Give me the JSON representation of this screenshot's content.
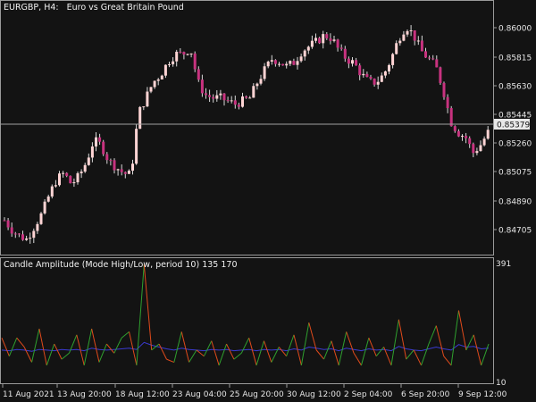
{
  "main_chart": {
    "symbol_label": "EURGBP, H4:",
    "description": "Euro vs Great Britain Pound",
    "price_ticks": [
      "0.86000",
      "0.85815",
      "0.85630",
      "0.85445",
      "0.85260",
      "0.85075",
      "0.84890",
      "0.84705"
    ],
    "current_price": "0.85379",
    "colors": {
      "bull": "#ffd4d4",
      "bear": "#c8327f",
      "wick": "#d9d9d9",
      "crosshair": "#a0a0a0",
      "price_tag_bg": "#e8e8e8",
      "price_tag_text": "#131313"
    }
  },
  "indicator": {
    "title": "Candle Amplitude (Mode High/Low, period 10) 135 170",
    "ticks": [
      "391",
      "10"
    ],
    "colors": {
      "up": "#2fa12f",
      "down": "#e04a1b",
      "avg": "#3a3ad0"
    }
  },
  "time_axis": {
    "labels": [
      "11 Aug 2021",
      "13 Aug 20:00",
      "18 Aug 12:00",
      "23 Aug 04:00",
      "25 Aug 20:00",
      "30 Aug 12:00",
      "2 Sep 04:00",
      "6 Sep 20:00",
      "9 Sep 12:00"
    ]
  },
  "chart_data": [
    {
      "type": "candlestick",
      "title": "EURGBP, H4: Euro vs Great Britain Pound",
      "ylim": [
        0.8463,
        0.8619
      ],
      "x_labels": [
        "11 Aug 2021",
        "13 Aug 20:00",
        "18 Aug 12:00",
        "23 Aug 04:00",
        "25 Aug 20:00",
        "30 Aug 12:00",
        "2 Sep 04:00",
        "6 Sep 20:00",
        "9 Sep 12:00"
      ],
      "close_path": [
        0.8482,
        0.8476,
        0.8472,
        0.847,
        0.8478,
        0.8486,
        0.8498,
        0.8508,
        0.8512,
        0.8505,
        0.851,
        0.8519,
        0.8533,
        0.853,
        0.852,
        0.8516,
        0.8512,
        0.8511,
        0.855,
        0.856,
        0.857,
        0.8575,
        0.8583,
        0.8588,
        0.8588,
        0.8592,
        0.857,
        0.8562,
        0.856,
        0.856,
        0.8558,
        0.8556,
        0.8558,
        0.856,
        0.857,
        0.8578,
        0.8585,
        0.8583,
        0.858,
        0.8583,
        0.859,
        0.8593,
        0.8596,
        0.86,
        0.8598,
        0.859,
        0.8585,
        0.8582,
        0.8575,
        0.857,
        0.857,
        0.8575,
        0.8585,
        0.8598,
        0.8606,
        0.86,
        0.859,
        0.8585,
        0.858,
        0.8565,
        0.8545,
        0.8538,
        0.8535,
        0.8525,
        0.853,
        0.8538
      ]
    },
    {
      "type": "line",
      "title": "Candle Amplitude (Mode High/Low, period 10) 135 170",
      "ylim": [
        10,
        391
      ],
      "series": [
        {
          "values": [
            150,
            90,
            150,
            120,
            70,
            180,
            60,
            130,
            80,
            100,
            160,
            60,
            180,
            70,
            130,
            100,
            150,
            170,
            60,
            391,
            110,
            130,
            80,
            70,
            170,
            70,
            110,
            90,
            140,
            60,
            130,
            80,
            100,
            150,
            60,
            140,
            70,
            120,
            90,
            160,
            60,
            200,
            110,
            80,
            140,
            60,
            170,
            100,
            60,
            150,
            90,
            120,
            60,
            210,
            80,
            110,
            60,
            130,
            190,
            90,
            60,
            240,
            110,
            160,
            60,
            130
          ]
        },
        {
          "values": [
            110,
            108,
            112,
            110,
            106,
            112,
            110,
            108,
            112,
            110,
            112,
            108,
            116,
            112,
            110,
            112,
            114,
            116,
            112,
            135,
            126,
            120,
            114,
            110,
            116,
            112,
            110,
            108,
            112,
            110,
            112,
            108,
            110,
            112,
            108,
            112,
            110,
            112,
            108,
            114,
            110,
            120,
            116,
            112,
            114,
            108,
            116,
            112,
            108,
            114,
            110,
            112,
            108,
            122,
            114,
            110,
            108,
            114,
            120,
            114,
            110,
            128,
            120,
            122,
            114,
            116
          ]
        }
      ]
    }
  ]
}
